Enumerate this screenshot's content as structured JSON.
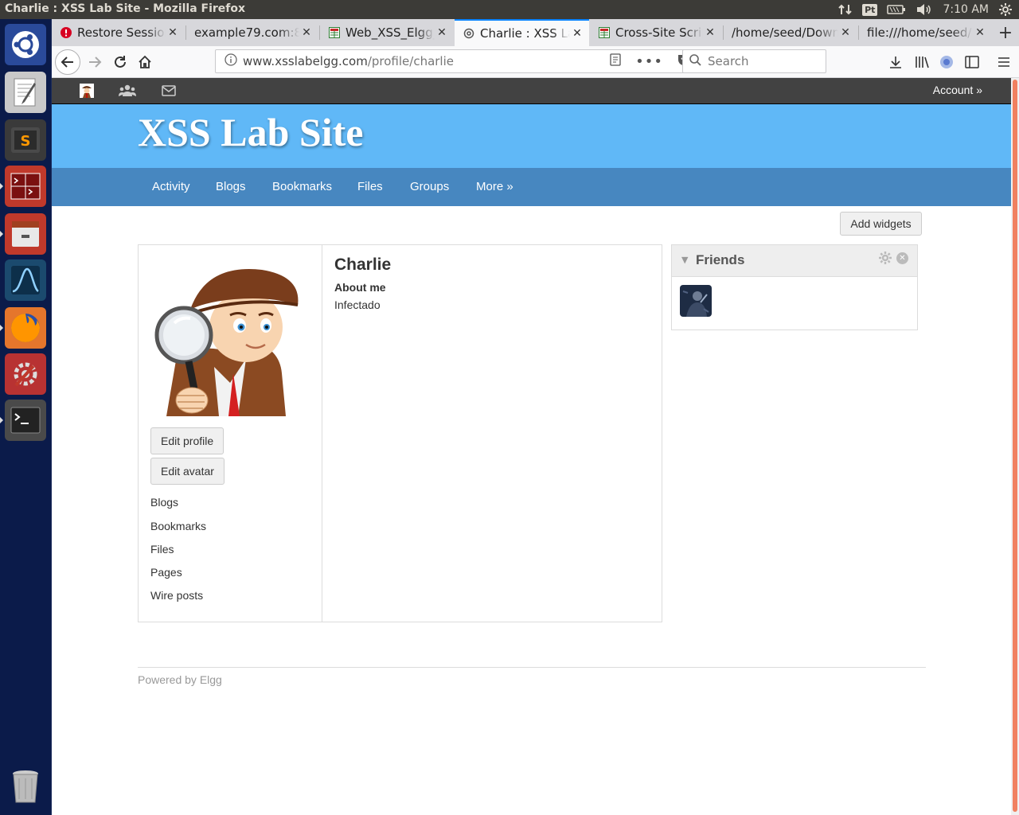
{
  "window": {
    "title": "Charlie : XSS Lab Site - Mozilla Firefox"
  },
  "system": {
    "keyboard_layout": "Pt",
    "clock": "7:10 AM"
  },
  "tabs": [
    {
      "label": "Restore Session",
      "icon": "warning-icon"
    },
    {
      "label": "example79.com:80",
      "icon": "page-icon"
    },
    {
      "label": "Web_XSS_Elgg_",
      "icon": "doc-icon"
    },
    {
      "label": "Charlie : XSS Lab",
      "icon": "elgg-icon"
    },
    {
      "label": "Cross-Site Script",
      "icon": "doc-icon"
    },
    {
      "label": "/home/seed/Down",
      "icon": "folder-icon"
    },
    {
      "label": "file:///home/seed/",
      "icon": "file-icon"
    }
  ],
  "address_bar": {
    "domain": "www.xsslabelgg.com",
    "path": "/profile/charlie"
  },
  "search": {
    "placeholder": "Search"
  },
  "elgg": {
    "account_label": "Account »",
    "site_title": "XSS Lab Site",
    "menu": [
      "Activity",
      "Blogs",
      "Bookmarks",
      "Files",
      "Groups",
      "More »"
    ],
    "add_widgets_label": "Add widgets",
    "profile": {
      "name": "Charlie",
      "about_label": "About me",
      "about_value": "Infectado",
      "edit_profile_label": "Edit profile",
      "edit_avatar_label": "Edit avatar",
      "links": [
        "Blogs",
        "Bookmarks",
        "Files",
        "Pages",
        "Wire posts"
      ]
    },
    "friends_widget": {
      "title": "Friends"
    },
    "footer": "Powered by Elgg"
  }
}
